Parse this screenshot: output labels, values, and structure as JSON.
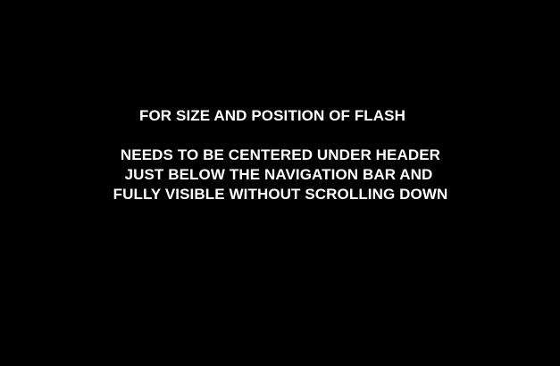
{
  "placeholder": {
    "background_color": "#000000",
    "text_color": "#ffffff",
    "title": "FOR SIZE AND POSITION OF FLASH",
    "lines": [
      "NEEDS TO BE CENTERED UNDER HEADER",
      "JUST BELOW THE NAVIGATION BAR AND",
      "FULLY VISIBLE WITHOUT SCROLLING DOWN"
    ]
  }
}
